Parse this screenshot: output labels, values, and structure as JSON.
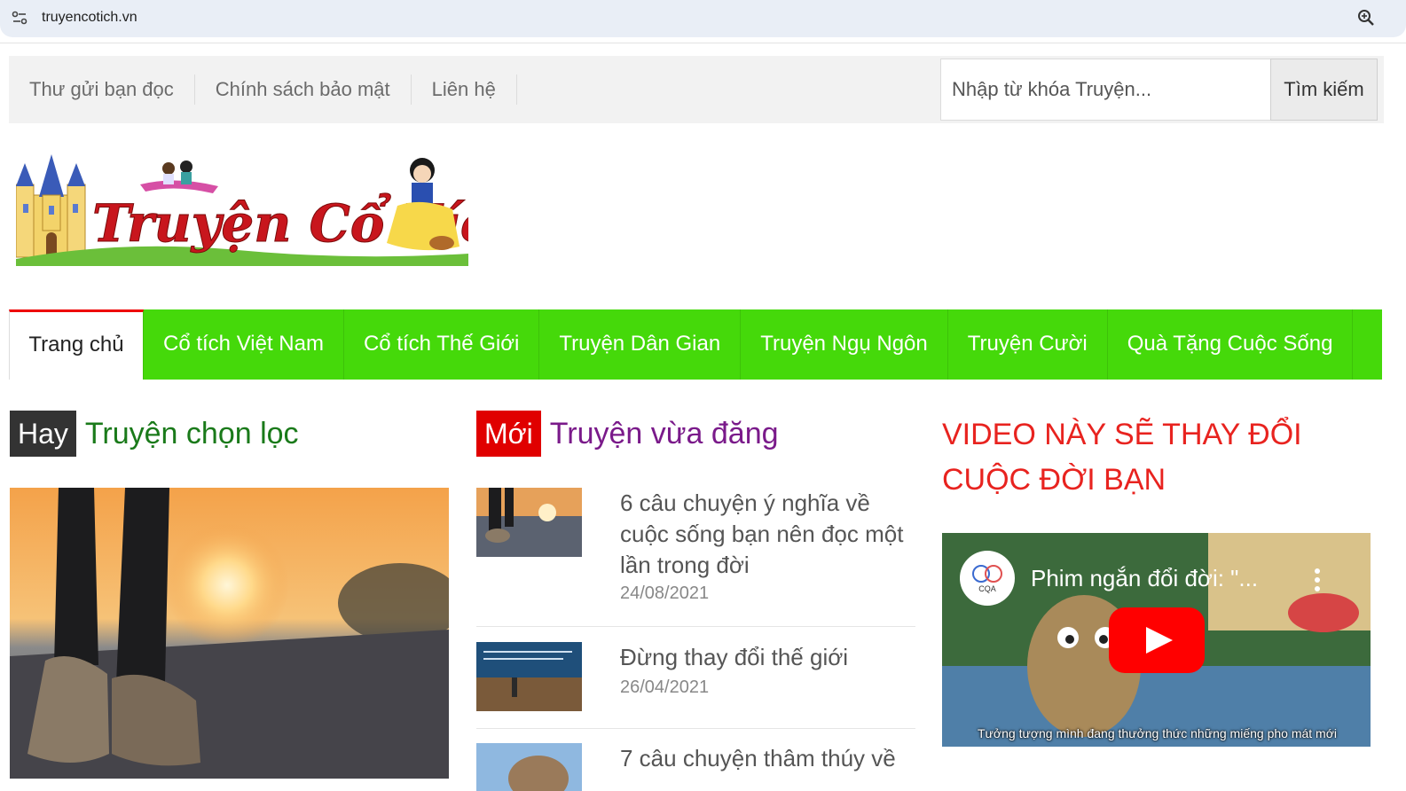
{
  "browser": {
    "url": "truyencotich.vn"
  },
  "topbar": {
    "links": [
      "Thư gửi bạn đọc",
      "Chính sách bảo mật",
      "Liên hệ"
    ],
    "search_placeholder": "Nhập từ khóa Truyện...",
    "search_button": "Tìm kiếm"
  },
  "logo": {
    "text": "Truyện Cổ Tích"
  },
  "nav": {
    "items": [
      "Trang chủ",
      "Cổ tích Việt Nam",
      "Cổ tích Thế Giới",
      "Truyện Dân Gian",
      "Truyện Ngụ Ngôn",
      "Truyện Cười",
      "Quà Tặng Cuộc Sống"
    ],
    "active": "Trang chủ"
  },
  "featured": {
    "tag": "Hay",
    "title": "Truyện chọn lọc"
  },
  "latest": {
    "tag": "Mới",
    "title": "Truyện vừa đăng",
    "items": [
      {
        "title": "6 câu chuyện ý nghĩa về cuộc sống bạn nên đọc một lần trong đời",
        "date": "24/08/2021"
      },
      {
        "title": "Đừng thay đổi thế giới",
        "date": "26/04/2021"
      },
      {
        "title": "7 câu chuyện thâm thúy về",
        "date": ""
      }
    ]
  },
  "video": {
    "heading": "VIDEO NÀY SẼ THAY ĐỔI CUỘC ĐỜI BẠN",
    "title": "Phim ngắn đổi đời: \"...",
    "channel_logo_text": "CQA",
    "subtitle": "Tưởng tượng mình đang thưởng thức những miếng pho mát mới"
  },
  "colors": {
    "nav_green": "#45d90a",
    "tag_dark": "#333333",
    "tag_red": "#e00000",
    "featured_title": "#1a7a1a",
    "latest_title": "#7a1a8a",
    "video_heading": "#e8231f"
  }
}
